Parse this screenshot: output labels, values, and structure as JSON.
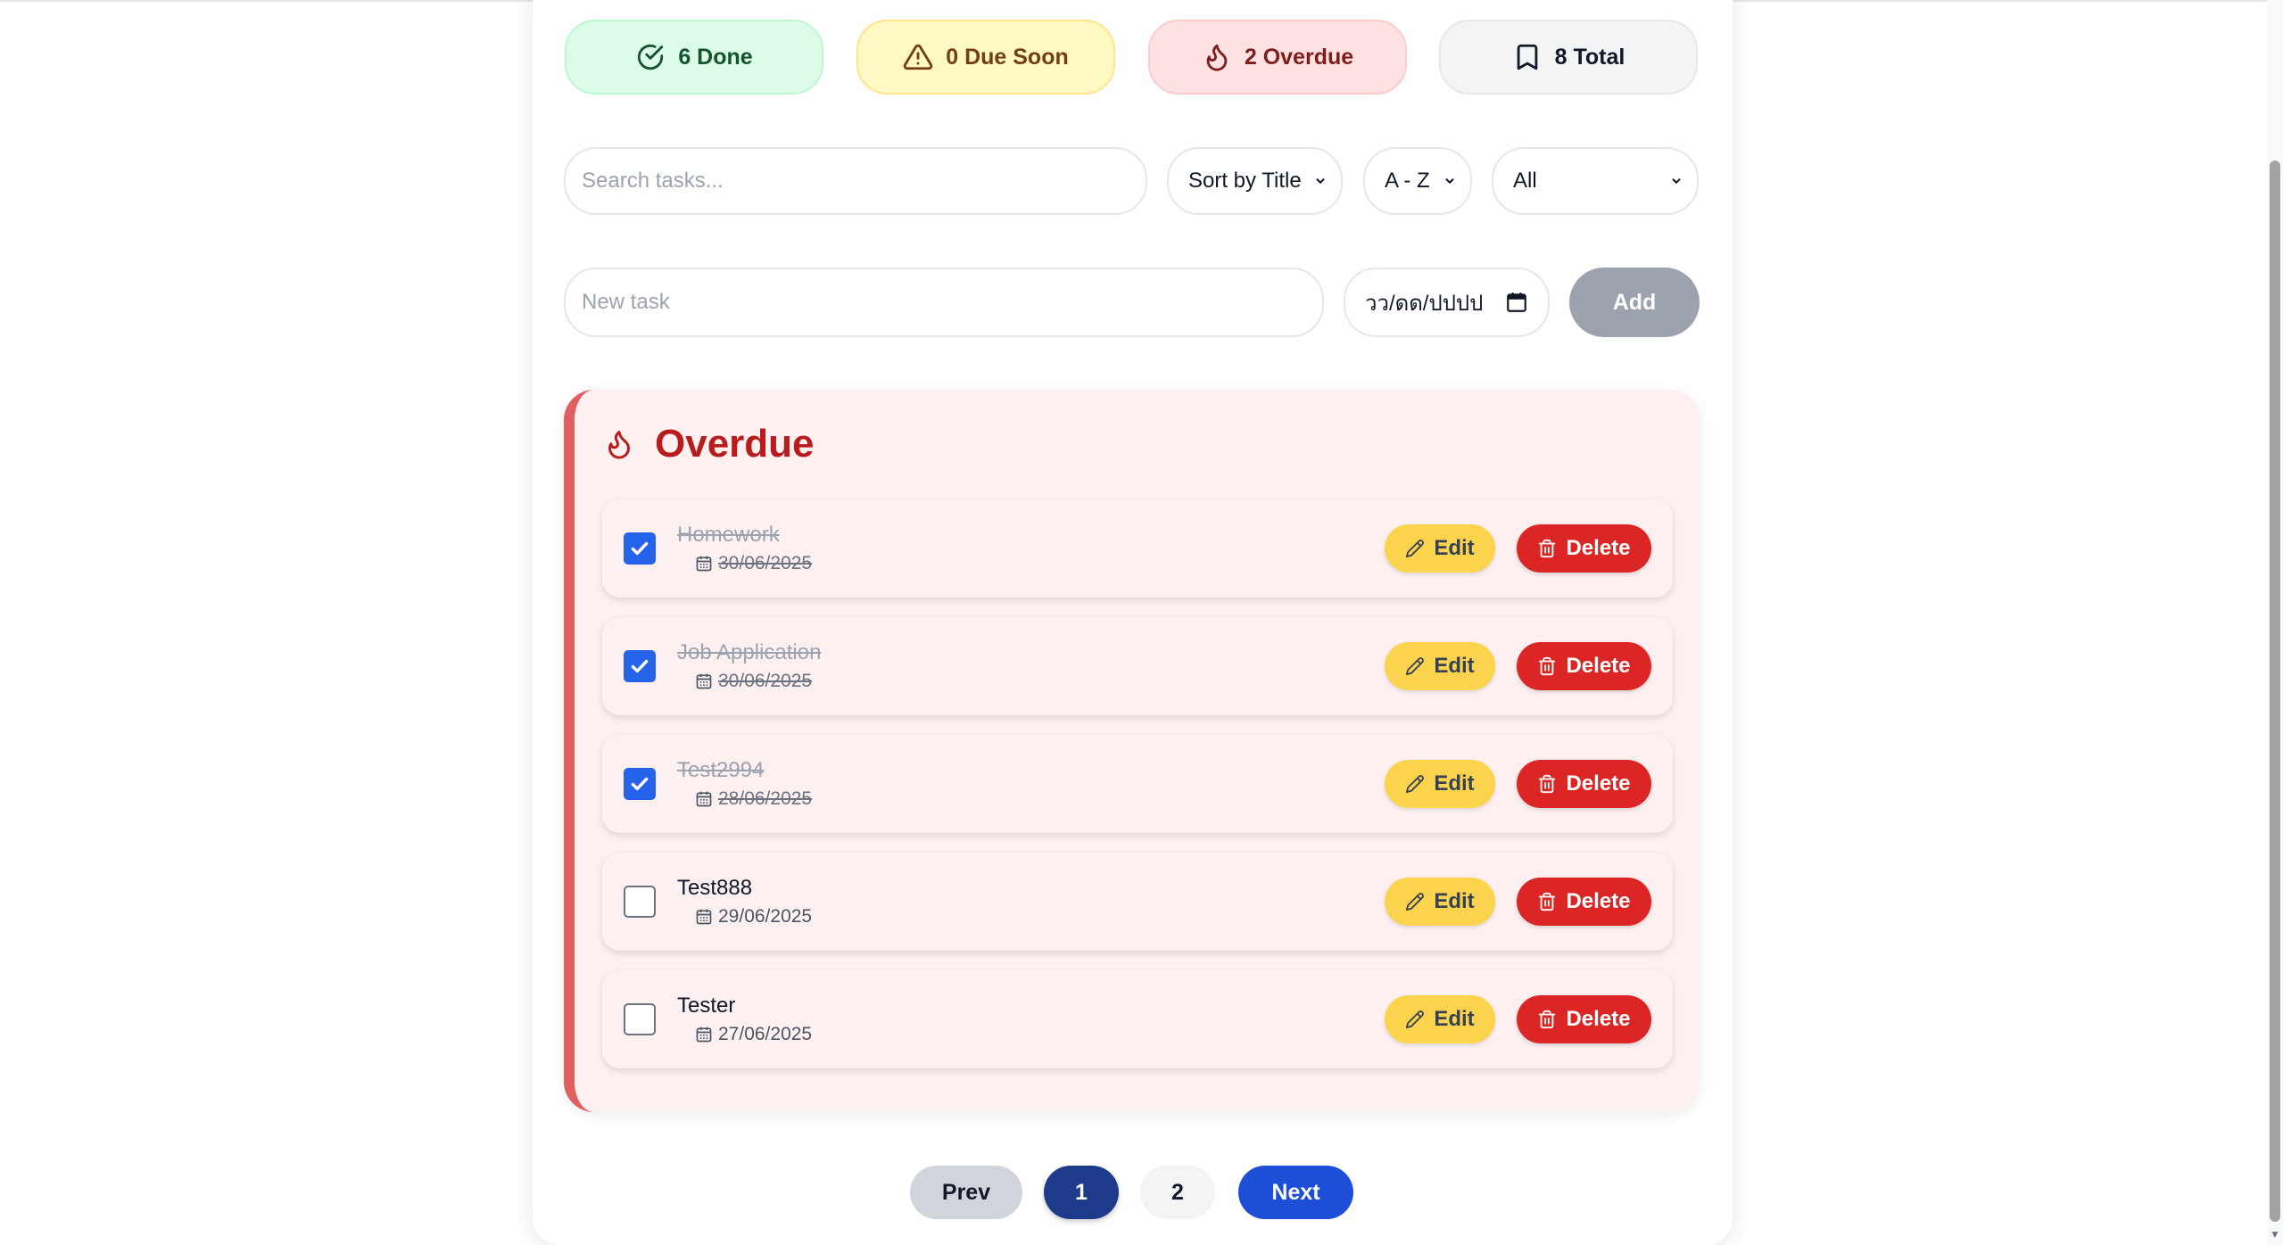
{
  "stats": {
    "done": "6 Done",
    "due_soon": "0 Due Soon",
    "overdue": "2 Overdue",
    "total": "8 Total"
  },
  "controls": {
    "search_placeholder": "Search tasks...",
    "sort_value": "Sort by Title",
    "order_value": "A - Z",
    "filter_value": "All",
    "new_task_placeholder": "New task",
    "date_placeholder": "วว/ดด/ปปปป",
    "add_label": "Add"
  },
  "section": {
    "title": "Overdue",
    "tasks": [
      {
        "title": "Homework",
        "date": "30/06/2025",
        "done": true
      },
      {
        "title": "Job Application",
        "date": "30/06/2025",
        "done": true
      },
      {
        "title": "Test2994",
        "date": "28/06/2025",
        "done": true
      },
      {
        "title": "Test888",
        "date": "29/06/2025",
        "done": false
      },
      {
        "title": "Tester",
        "date": "27/06/2025",
        "done": false
      }
    ],
    "edit_label": "Edit",
    "delete_label": "Delete"
  },
  "pagination": {
    "prev": "Prev",
    "pages": [
      "1",
      "2"
    ],
    "current": "1",
    "next": "Next"
  },
  "colors": {
    "done_bg": "#dcfce7",
    "due_soon_bg": "#fef9c3",
    "overdue_bg": "#fee2e2",
    "accent_blue": "#2563eb",
    "delete_red": "#dc2626",
    "edit_yellow": "#fcd34d"
  },
  "icons": {
    "done": "check-circle-icon",
    "due_soon": "warning-triangle-icon",
    "overdue": "flame-icon",
    "total": "bookmark-icon",
    "edit": "pencil-icon",
    "delete": "trash-icon",
    "date": "calendar-icon"
  }
}
